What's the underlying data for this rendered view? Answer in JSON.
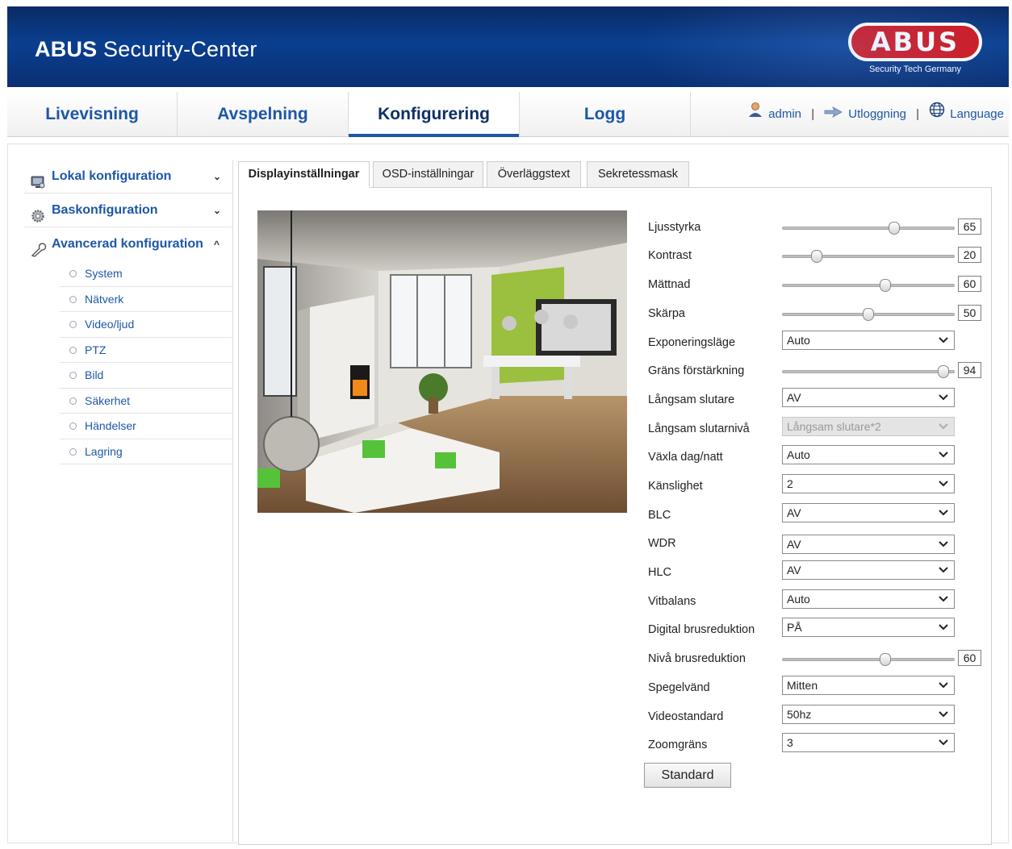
{
  "header": {
    "app_title_bold": "ABUS",
    "app_title_rest": " Security-Center",
    "logo_text": "ABUS",
    "logo_tagline": "Security Tech Germany"
  },
  "nav": {
    "tabs": [
      {
        "label": "Livevisning"
      },
      {
        "label": "Avspelning"
      },
      {
        "label": "Konfigurering"
      },
      {
        "label": "Logg"
      }
    ],
    "active_tab": "Konfigurering",
    "user": "admin",
    "logout": "Utloggning",
    "language": "Language",
    "separator": "|"
  },
  "sidebar": {
    "sections": [
      {
        "label": "Lokal konfiguration",
        "chevron": "⌄"
      },
      {
        "label": "Baskonfiguration",
        "chevron": "⌄"
      },
      {
        "label": "Avancerad konfiguration",
        "chevron": "^"
      }
    ],
    "sub_items": [
      {
        "label": "System"
      },
      {
        "label": "Nätverk"
      },
      {
        "label": "Video/ljud"
      },
      {
        "label": "PTZ"
      },
      {
        "label": "Bild"
      },
      {
        "label": "Säkerhet"
      },
      {
        "label": "Händelser"
      },
      {
        "label": "Lagring"
      }
    ]
  },
  "tabs": [
    {
      "label": "Displayinställningar"
    },
    {
      "label": "OSD-inställningar"
    },
    {
      "label": "Överläggstext"
    },
    {
      "label": "Sekretessmask"
    }
  ],
  "settings": {
    "brightness": {
      "label": "Ljusstyrka",
      "value": "65",
      "fraction": 0.65
    },
    "contrast": {
      "label": "Kontrast",
      "value": "20",
      "fraction": 0.2
    },
    "saturation": {
      "label": "Mättnad",
      "value": "60",
      "fraction": 0.6
    },
    "sharpness": {
      "label": "Skärpa",
      "value": "50",
      "fraction": 0.5
    },
    "exposure_mode": {
      "label": "Exponeringsläge",
      "value": "Auto"
    },
    "gain_limit": {
      "label": "Gräns förstärkning",
      "value": "94",
      "fraction": 0.94
    },
    "slow_shutter": {
      "label": "Långsam slutare",
      "value": "AV"
    },
    "slow_shutter_level": {
      "label": "Långsam slutarnivå",
      "value": "Långsam slutare*2"
    },
    "day_night": {
      "label": "Växla dag/natt",
      "value": "Auto"
    },
    "sensitivity": {
      "label": "Känslighet",
      "value": "2"
    },
    "blc": {
      "label": "BLC",
      "value": "AV"
    },
    "wdr": {
      "label": "WDR",
      "value": "AV"
    },
    "hlc": {
      "label": "HLC",
      "value": "AV"
    },
    "white_balance": {
      "label": "Vitbalans",
      "value": "Auto"
    },
    "digital_nr": {
      "label": "Digital brusreduktion",
      "value": "PÅ"
    },
    "nr_level": {
      "label": "Nivå brusreduktion",
      "value": "60",
      "fraction": 0.6
    },
    "mirror": {
      "label": "Spegelvänd",
      "value": "Mitten"
    },
    "video_standard": {
      "label": "Videostandard",
      "value": "50hz"
    },
    "zoom_limit": {
      "label": "Zoomgräns",
      "value": "3"
    }
  },
  "standard_button": "Standard",
  "colors": {
    "link_blue": "#1d57a6",
    "header_blue": "#0a3f8f",
    "logo_red": "#d0161c"
  }
}
